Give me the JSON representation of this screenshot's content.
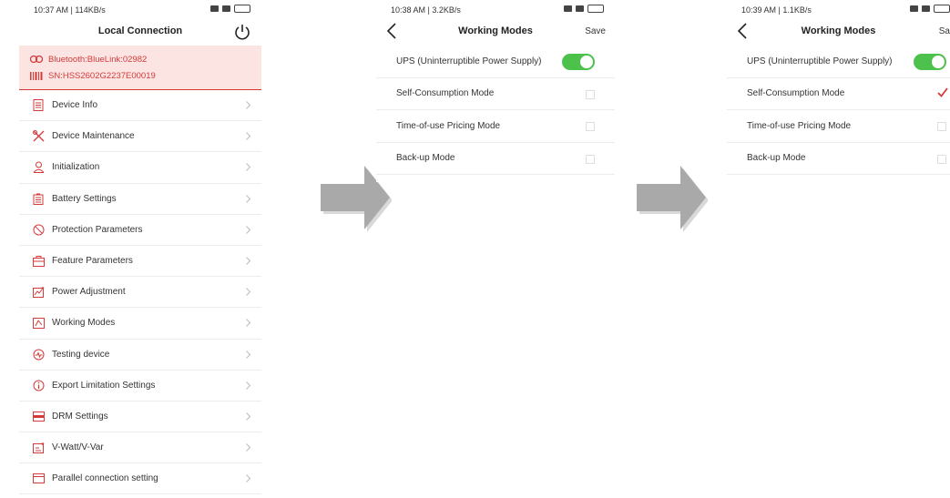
{
  "screen1": {
    "status_time": "10:37 AM | 114KB/s",
    "title": "Local Connection",
    "bluetooth": "Bluetooth:BlueLink:02982",
    "serial": "SN:HSS2602G2237E00019",
    "menu": [
      {
        "label": "Device Info",
        "icon": "document-icon"
      },
      {
        "label": "Device Maintenance",
        "icon": "tools-icon"
      },
      {
        "label": "Initialization",
        "icon": "user-settings-icon"
      },
      {
        "label": "Battery Settings",
        "icon": "battery-icon"
      },
      {
        "label": "Protection Parameters",
        "icon": "protection-icon"
      },
      {
        "label": "Feature Parameters",
        "icon": "feature-icon"
      },
      {
        "label": "Power Adjustment",
        "icon": "power-adjust-icon"
      },
      {
        "label": "Working Modes",
        "icon": "working-modes-icon"
      },
      {
        "label": "Testing device",
        "icon": "testing-icon"
      },
      {
        "label": "Export Limitation Settings",
        "icon": "info-icon"
      },
      {
        "label": "DRM Settings",
        "icon": "drm-icon"
      },
      {
        "label": "V-Watt/V-Var",
        "icon": "chart-icon"
      },
      {
        "label": "Parallel connection setting",
        "icon": "window-icon"
      }
    ]
  },
  "screen2": {
    "status_time": "10:38 AM | 3.2KB/s",
    "title": "Working Modes",
    "save_label": "Save",
    "modes": [
      {
        "label": "UPS (Uninterruptible Power Supply)",
        "control": "toggle",
        "on": true
      },
      {
        "label": "Self-Consumption Mode",
        "control": "checkbox",
        "checked": false
      },
      {
        "label": "Time-of-use Pricing Mode",
        "control": "checkbox",
        "checked": false
      },
      {
        "label": "Back-up Mode",
        "control": "checkbox",
        "checked": false
      }
    ]
  },
  "screen3": {
    "status_time": "10:39 AM | 1.1KB/s",
    "title": "Working Modes",
    "save_label": "Sa",
    "modes": [
      {
        "label": "UPS (Uninterruptible Power Supply)",
        "control": "toggle",
        "on": true
      },
      {
        "label": "Self-Consumption Mode",
        "control": "checkbox",
        "checked": true
      },
      {
        "label": "Time-of-use Pricing Mode",
        "control": "checkbox",
        "checked": false
      },
      {
        "label": "Back-up Mode",
        "control": "checkbox",
        "checked": false
      }
    ]
  },
  "colors": {
    "accent_red": "#d43b3b",
    "toggle_green": "#4cc14c",
    "arrow_gray": "#a9a9a9"
  }
}
